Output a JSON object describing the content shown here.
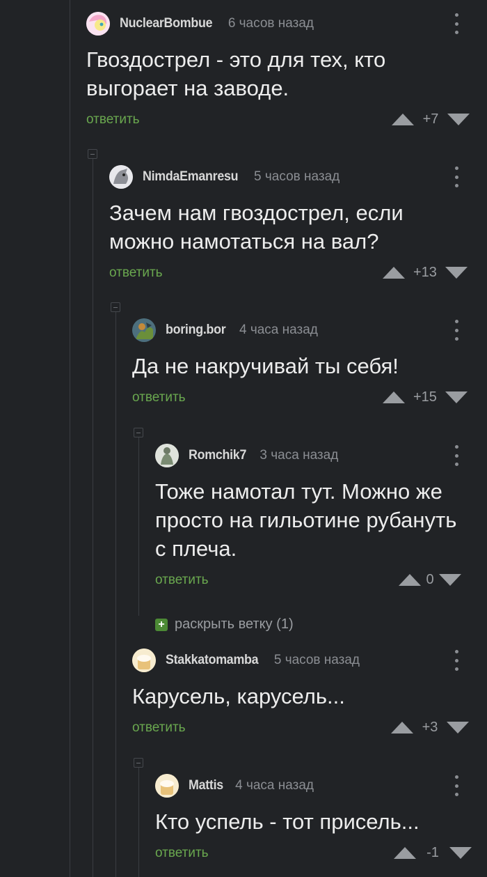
{
  "comments": [
    {
      "username": "NuclearBombue",
      "time": "6 часов назад",
      "text": "Гвоздострел - это для тех, кто выгорает на заводе.",
      "reply": "ответить",
      "score": "+7"
    },
    {
      "username": "NimdaEmanresu",
      "time": "5 часов назад",
      "text": "Зачем нам гвоздострел, если можно намотаться на вал?",
      "reply": "ответить",
      "score": "+13"
    },
    {
      "username": "boring.bor",
      "time": "4 часа назад",
      "text": "Да не накручивай ты себя!",
      "reply": "ответить",
      "score": "+15"
    },
    {
      "username": "Romchik7",
      "time": "3 часа назад",
      "text": "Тоже намотал тут. Можно же просто на гильотине рубануть с плеча.",
      "reply": "ответить",
      "score": "0"
    },
    {
      "username": "Stakkatomamba",
      "time": "5 часов назад",
      "text": "Карусель, карусель...",
      "reply": "ответить",
      "score": "+3"
    },
    {
      "username": "Mattis",
      "time": "4 часа назад",
      "text": "Кто успель - тот присель...",
      "reply": "ответить",
      "score": "-1"
    }
  ],
  "expand_thread": {
    "label": "раскрыть ветку (1)"
  },
  "colors": {
    "background": "#212326",
    "accent_green": "#6aa84f",
    "muted": "#8b8e93"
  }
}
